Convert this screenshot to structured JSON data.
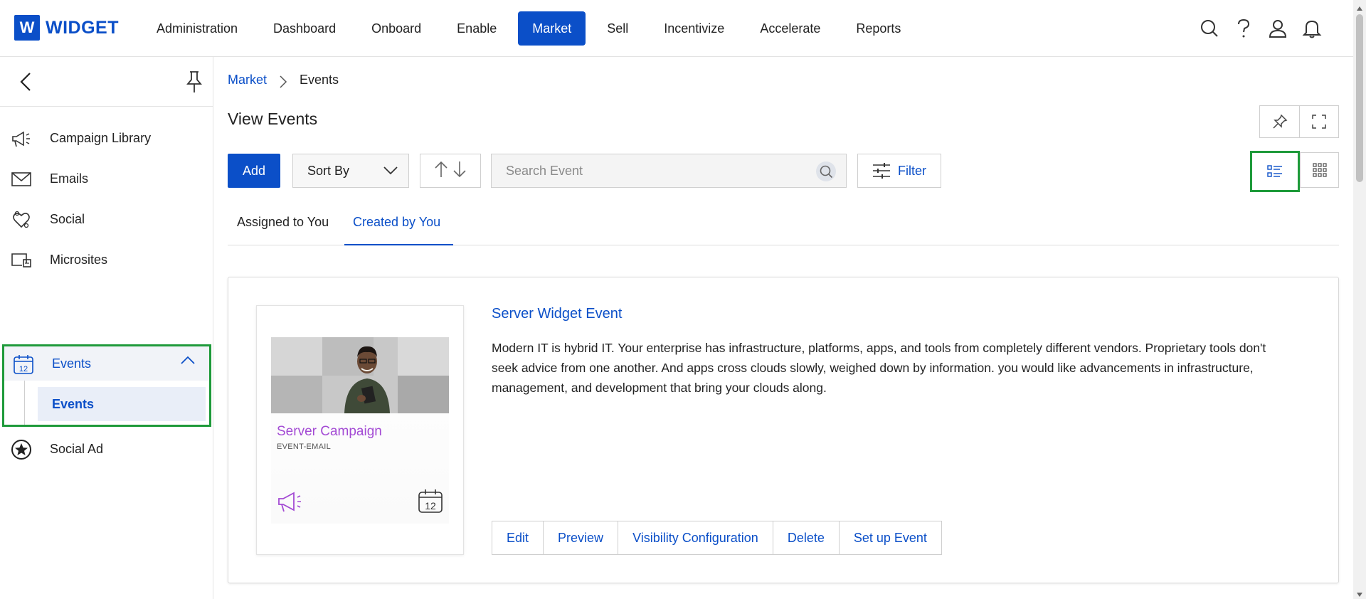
{
  "brand": {
    "logo_letter": "W",
    "logo_text": "WIDGET",
    "color": "#0b4fc8"
  },
  "nav": {
    "items": [
      {
        "label": "Administration",
        "active": false
      },
      {
        "label": "Dashboard",
        "active": false
      },
      {
        "label": "Onboard",
        "active": false
      },
      {
        "label": "Enable",
        "active": false
      },
      {
        "label": "Market",
        "active": true
      },
      {
        "label": "Sell",
        "active": false
      },
      {
        "label": "Incentivize",
        "active": false
      },
      {
        "label": "Accelerate",
        "active": false
      },
      {
        "label": "Reports",
        "active": false
      }
    ],
    "icons": [
      "search-icon",
      "help-icon",
      "user-icon",
      "bell-icon"
    ]
  },
  "sidebar": {
    "items": [
      {
        "label": "Campaign Library",
        "icon": "megaphone-icon"
      },
      {
        "label": "Emails",
        "icon": "envelope-icon"
      },
      {
        "label": "Social",
        "icon": "social-icon"
      },
      {
        "label": "Microsites",
        "icon": "microsite-icon"
      },
      {
        "label": "Events",
        "icon": "calendar-icon",
        "expanded": true,
        "calendar_day": "12"
      },
      {
        "label": "Social Ad",
        "icon": "star-badge-icon"
      }
    ],
    "events_sub": {
      "label": "Events"
    }
  },
  "breadcrumb": {
    "parent": "Market",
    "current": "Events"
  },
  "page": {
    "title": "View Events"
  },
  "toolbar": {
    "add_label": "Add",
    "sort_label": "Sort By",
    "search_placeholder": "Search Event",
    "search_value": "",
    "filter_label": "Filter"
  },
  "tabs": [
    {
      "label": "Assigned to You",
      "active": false
    },
    {
      "label": "Created by You",
      "active": true
    }
  ],
  "event": {
    "title": "Server Widget Event",
    "description": "Modern IT is hybrid IT. Your enterprise has infrastructure, platforms, apps, and tools from completely different vendors. Proprietary tools don't seek advice from one another. And apps cross clouds slowly, weighed down by information. you would like advancements in infrastructure, management, and development that bring your clouds along.",
    "thumb_title": "Server Campaign",
    "thumb_subtitle": "EVENT-EMAIL",
    "thumb_calendar_day": "12",
    "actions": [
      "Edit",
      "Preview",
      "Visibility Configuration",
      "Delete",
      "Set up Event"
    ]
  },
  "colors": {
    "accent": "#0b4fc8",
    "highlight": "#1e9a3a",
    "thumb_accent": "#a34ad4"
  }
}
